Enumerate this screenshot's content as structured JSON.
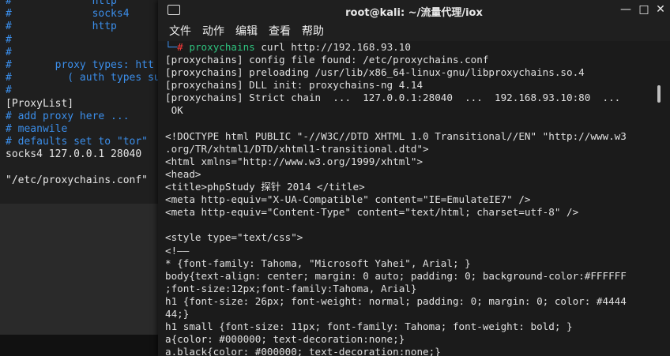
{
  "background_terminal": {
    "lines": [
      {
        "text": "#             http",
        "color": "blue"
      },
      {
        "text": "#             socks4",
        "color": "blue"
      },
      {
        "text": "#             http",
        "color": "blue"
      },
      {
        "text": "#",
        "color": "blue"
      },
      {
        "text": "#",
        "color": "blue"
      },
      {
        "text": "#       proxy types: htt",
        "color": "blue"
      },
      {
        "text": "#         ( auth types su",
        "color": "blue"
      },
      {
        "text": "#",
        "color": "blue"
      },
      {
        "text": "[ProxyList]",
        "color": "white"
      },
      {
        "text": "# add proxy here ...",
        "color": "blue"
      },
      {
        "text": "# meanwile",
        "color": "blue"
      },
      {
        "text": "# defaults set to \"tor\"",
        "color": "blue"
      },
      {
        "text": "socks4 127.0.0.1 28040",
        "color": "white"
      },
      {
        "text": "",
        "color": "white"
      },
      {
        "text": "\"/etc/proxychains.conf\"",
        "color": "white"
      }
    ]
  },
  "window": {
    "title": "root@kali: ~/流量代理/iox",
    "icon": "terminal-icon",
    "minimize_label": "—",
    "maximize_label": "□",
    "close_label": "✕"
  },
  "menu": [
    "文件",
    "动作",
    "编辑",
    "查看",
    "帮助"
  ],
  "terminal": {
    "prompt_corner": "└─",
    "prompt_hash": "#",
    "command_name": "proxychains",
    "command_args": " curl http://192.168.93.10",
    "output": [
      "[proxychains] config file found: /etc/proxychains.conf",
      "[proxychains] preloading /usr/lib/x86_64-linux-gnu/libproxychains.so.4",
      "[proxychains] DLL init: proxychains-ng 4.14",
      "[proxychains] Strict chain  ...  127.0.0.1:28040  ...  192.168.93.10:80  ...",
      " OK",
      "",
      "<!DOCTYPE html PUBLIC \"-//W3C//DTD XHTML 1.0 Transitional//EN\" \"http://www.w3",
      ".org/TR/xhtml1/DTD/xhtml1-transitional.dtd\">",
      "<html xmlns=\"http://www.w3.org/1999/xhtml\">",
      "<head>",
      "<title>phpStudy 探针 2014 </title>",
      "<meta http-equiv=\"X-UA-Compatible\" content=\"IE=EmulateIE7\" />",
      "<meta http-equiv=\"Content-Type\" content=\"text/html; charset=utf-8\" />",
      "",
      "<style type=\"text/css\">",
      "<!——",
      "* {font-family: Tahoma, \"Microsoft Yahei\", Arial; }",
      "body{text-align: center; margin: 0 auto; padding: 0; background-color:#FFFFFF",
      ";font-size:12px;font-family:Tahoma, Arial}",
      "h1 {font-size: 26px; font-weight: normal; padding: 0; margin: 0; color: #4444",
      "44;}",
      "h1 small {font-size: 11px; font-family: Tahoma; font-weight: bold; }",
      "a{color: #000000; text-decoration:none;}",
      "a.black{color: #000000; text-decoration:none;}"
    ]
  },
  "colors": {
    "prompt_blue": "#3b8eea",
    "prompt_red": "#ff3b3b",
    "command_green": "#2ec27e",
    "terminal_bg": "#1b1b1b"
  }
}
